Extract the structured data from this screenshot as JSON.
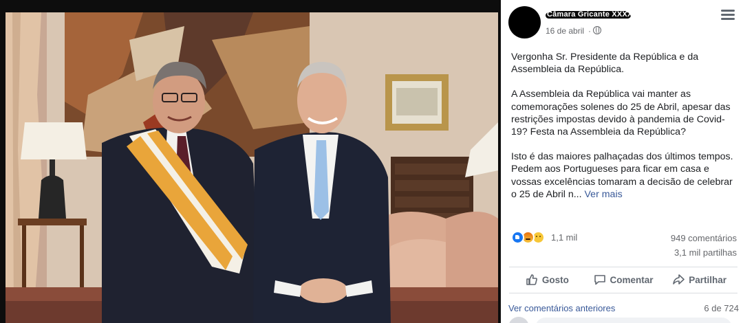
{
  "post": {
    "poster_name": "Câmara Gricante XXXX",
    "date": "16 de abril",
    "date_separator": "·",
    "paragraphs": [
      "Vergonha Sr. Presidente da República e da Assembleia da República.",
      "A Assembleia da República vai manter as comemorações solenes do 25 de Abril, apesar das restrições impostas devido à pandemia de Covid-19? Festa na Assembleia da República?"
    ],
    "last_paragraph": "Isto é das maiores palhaçadas dos últimos tempos. Pedem aos Portugueses para ficar em casa e vossas excelências tomaram a decisão de celebrar o 25 de Abril n...",
    "see_more": "Ver mais"
  },
  "stats": {
    "reaction_icons": [
      "like-icon",
      "angry-icon",
      "sad-icon"
    ],
    "reactions": "1,1 mil",
    "comments": "949 comentários",
    "shares": "3,1 mil partilhas"
  },
  "actions": {
    "like": "Gosto",
    "comment": "Comentar",
    "share": "Partilhar"
  },
  "comments": {
    "view_previous": "Ver comentários anteriores",
    "pager": "6 de 724"
  },
  "colors": {
    "link": "#385898",
    "secondary_text": "#65676b",
    "like_blue": "#1877f2",
    "divider": "#dadde1"
  }
}
